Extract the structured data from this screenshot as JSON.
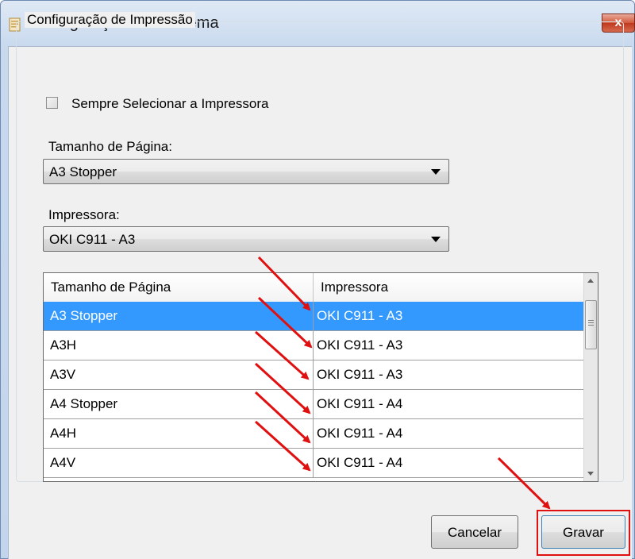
{
  "window": {
    "title": "Configurações do Sistema",
    "close_glyph": "x"
  },
  "group": {
    "legend": "Configuração de Impressão"
  },
  "always_select_printer": {
    "label": "Sempre Selecionar a Impressora",
    "checked": false
  },
  "page_size": {
    "label": "Tamanho de Página:",
    "value": "A3 Stopper"
  },
  "printer": {
    "label": "Impressora:",
    "value": "OKI C911 - A3"
  },
  "grid": {
    "columns": [
      "Tamanho de Página",
      "Impressora"
    ],
    "rows": [
      {
        "page_size": "A3 Stopper",
        "printer": "OKI C911 - A3",
        "selected": true
      },
      {
        "page_size": "A3H",
        "printer": "OKI C911 - A3",
        "selected": false
      },
      {
        "page_size": "A3V",
        "printer": "OKI C911 - A3",
        "selected": false
      },
      {
        "page_size": "A4 Stopper",
        "printer": "OKI C911 - A4",
        "selected": false
      },
      {
        "page_size": "A4H",
        "printer": "OKI C911 - A4",
        "selected": false
      },
      {
        "page_size": "A4V",
        "printer": "OKI C911 - A4",
        "selected": false
      }
    ]
  },
  "buttons": {
    "cancel": "Cancelar",
    "save": "Gravar"
  },
  "colors": {
    "selection": "#3399ff",
    "annotation": "#e01010"
  },
  "icons": [
    "app-icon",
    "close-icon",
    "checkbox-icon",
    "chevron-down-icon",
    "scroll-up-icon",
    "scroll-down-icon"
  ]
}
